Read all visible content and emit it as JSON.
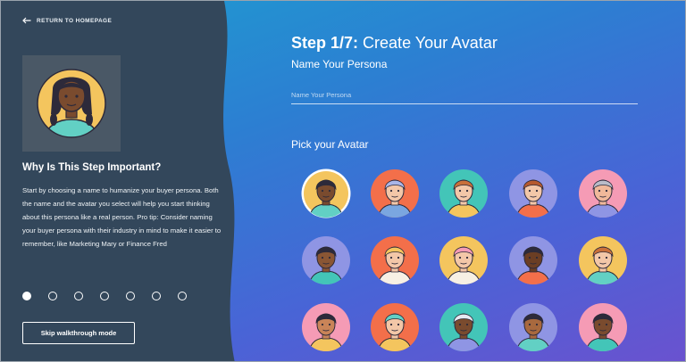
{
  "nav": {
    "back_label": "RETURN TO HOMEPAGE"
  },
  "sidebar": {
    "why_title": "Why Is This Step Important?",
    "why_body": "Start by choosing a name to humanize your buyer persona. Both the name and the avatar you select will help you start thinking about this persona like a real person. Pro tip: Consider naming your buyer persona with their industry in mind to make it easier to remember, like Marketing Mary or Finance Fred",
    "steps_total": 7,
    "current_step": 1,
    "skip_label": "Skip walkthrough mode"
  },
  "main": {
    "step_prefix": "Step 1/7:",
    "step_title": "Create Your Avatar",
    "persona_label": "Name Your Persona",
    "name_placeholder": "Name Your Persona",
    "name_value": "",
    "pick_label": "Pick your Avatar"
  },
  "avatars": [
    {
      "bg": "#f4c55e",
      "skin": "#7a4b2e",
      "hair": "#2d2a3a",
      "shirt": "#62d0c4",
      "selected": true
    },
    {
      "bg": "#f36f4a",
      "skin": "#f3c7a8",
      "hair": "#a9b6e8",
      "shirt": "#7aa6e0",
      "selected": false
    },
    {
      "bg": "#43c5b8",
      "skin": "#f3c7a8",
      "hair": "#c9703a",
      "shirt": "#f4c55e",
      "selected": false
    },
    {
      "bg": "#8f95e4",
      "skin": "#f3c7a8",
      "hair": "#b65a2e",
      "shirt": "#f36f4a",
      "selected": false
    },
    {
      "bg": "#f59bb5",
      "skin": "#f0b89a",
      "hair": "#b9bcc9",
      "shirt": "#8f95e4",
      "selected": false
    },
    {
      "bg": "#8f95e4",
      "skin": "#8a5634",
      "hair": "#2d2a3a",
      "shirt": "#43c5b8",
      "selected": false
    },
    {
      "bg": "#f36f4a",
      "skin": "#f3c7a8",
      "hair": "#f4c55e",
      "shirt": "#f7f0e4",
      "selected": false
    },
    {
      "bg": "#f4c55e",
      "skin": "#f3c7a8",
      "hair": "#f59bb5",
      "shirt": "#f7f0e4",
      "selected": false
    },
    {
      "bg": "#8f95e4",
      "skin": "#6b3e24",
      "hair": "#2d2a3a",
      "shirt": "#f36f4a",
      "selected": false
    },
    {
      "bg": "#f4c55e",
      "skin": "#f3c7a8",
      "hair": "#c9703a",
      "shirt": "#62d0c4",
      "selected": false
    },
    {
      "bg": "#f59bb5",
      "skin": "#c98458",
      "hair": "#2d2a3a",
      "shirt": "#f4c55e",
      "selected": false
    },
    {
      "bg": "#f36f4a",
      "skin": "#f3c7a8",
      "hair": "#62d0c4",
      "shirt": "#f4c55e",
      "selected": false
    },
    {
      "bg": "#43c5b8",
      "skin": "#7a4b2e",
      "hair": "#e6e9f2",
      "shirt": "#8f95e4",
      "selected": false
    },
    {
      "bg": "#8f95e4",
      "skin": "#a8693e",
      "hair": "#2d2a3a",
      "shirt": "#62d0c4",
      "selected": false
    },
    {
      "bg": "#f59bb5",
      "skin": "#7a4b2e",
      "hair": "#2d2a3a",
      "shirt": "#43c5b8",
      "selected": false
    }
  ],
  "colors": {
    "sidebar_bg": "#33475b",
    "accent_gradient_start": "#1d9ed0",
    "accent_gradient_end": "#6a52cf"
  },
  "icons": {
    "back": "arrow-left-icon"
  }
}
